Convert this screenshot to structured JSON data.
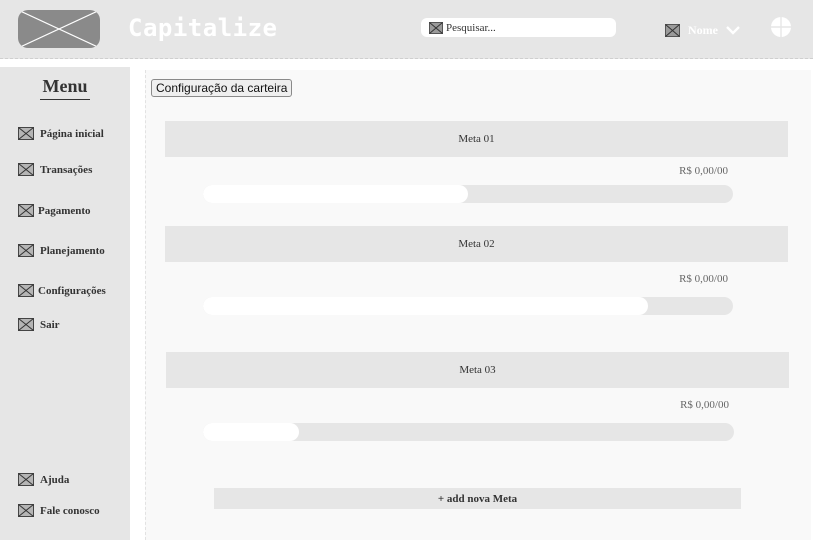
{
  "app": {
    "title": "Capitalize"
  },
  "search": {
    "placeholder": "Pesquisar..."
  },
  "user": {
    "name": "Nome"
  },
  "sidebar": {
    "menu_title": "Menu",
    "items": [
      {
        "label": "Página inicial"
      },
      {
        "label": "Transações"
      },
      {
        "label": "Pagamento"
      },
      {
        "label": "Planejamento"
      },
      {
        "label": "Configurações"
      },
      {
        "label": "Sair"
      }
    ],
    "bottom_items": [
      {
        "label": "Ajuda"
      },
      {
        "label": "Fale conosco"
      }
    ]
  },
  "main": {
    "config_button": "Configuração da carteira",
    "goals": [
      {
        "title": "Meta 01",
        "amount": "R$ 0,00/00",
        "progress": 0.5
      },
      {
        "title": "Meta 02",
        "amount": "R$ 0,00/00",
        "progress": 0.84
      },
      {
        "title": "Meta 03",
        "amount": "R$ 0,00/00",
        "progress": 0.18
      }
    ],
    "add_button": "+ add nova Meta"
  },
  "colors": {
    "header_bg": "#e6e6e6",
    "sidebar_bg": "#e6e6e6",
    "main_bg": "#f9f9f9",
    "logo_bg": "#8a8a8a"
  }
}
